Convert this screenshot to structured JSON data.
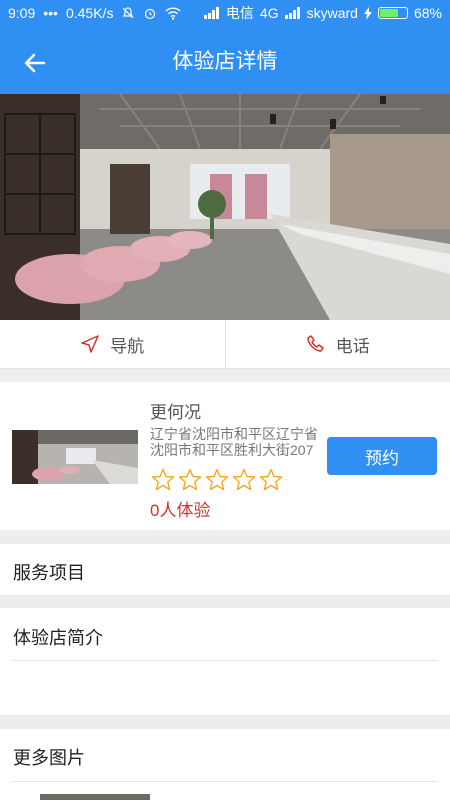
{
  "status_bar": {
    "time": "9:09",
    "dots": "•••",
    "speed": "0.45K/s",
    "carrier1": "电信",
    "network": "4G",
    "carrier2": "skyward",
    "battery": "68%",
    "battery_level": 0.68
  },
  "header": {
    "title": "体验店详情",
    "back_icon": "arrow-left-icon"
  },
  "actions": [
    {
      "label": "导航",
      "icon": "navigation-icon"
    },
    {
      "label": "电话",
      "icon": "phone-icon"
    }
  ],
  "store": {
    "name": "更何况",
    "address": "辽宁省沈阳市和平区辽宁省沈阳市和平区胜利大街207",
    "rating": 0,
    "rating_max": 5,
    "experience_count": "0人体验",
    "book_label": "预约"
  },
  "sections": {
    "services": "服务项目",
    "intro": "体验店简介",
    "more_images": "更多图片"
  },
  "colors": {
    "primary": "#2f8ff2",
    "accent_red": "#d1332e",
    "star": "#f5a623"
  }
}
